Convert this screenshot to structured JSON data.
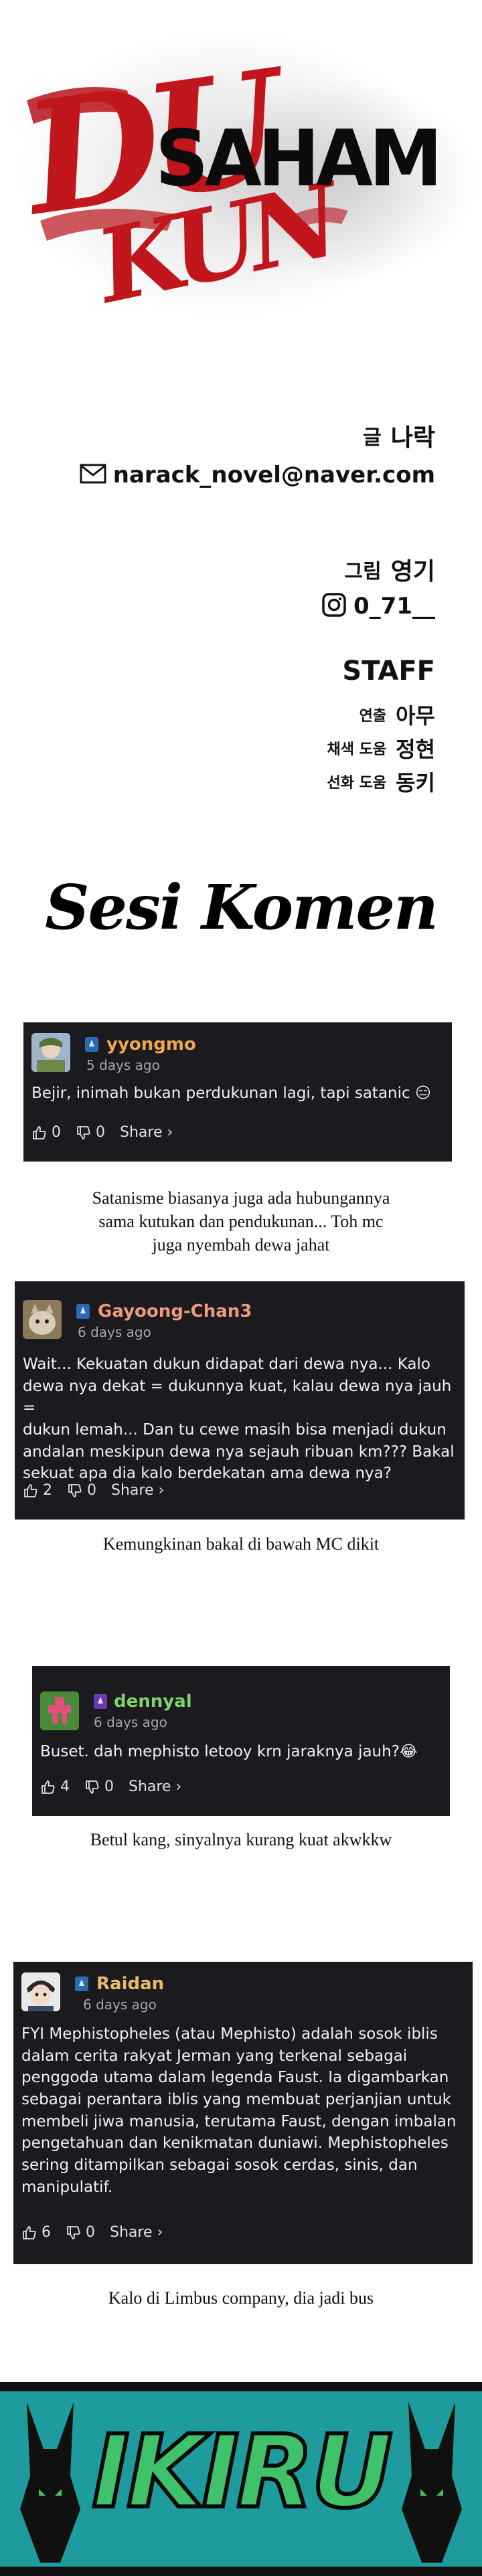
{
  "title": {
    "du": "DU",
    "kun": "KUN",
    "saham": "SAHAM"
  },
  "credits": {
    "writer_label": "글",
    "writer_name": "나락",
    "email": "narack_novel@naver.com",
    "artist_label": "그림",
    "artist_name": "영기",
    "instagram": "0_71__",
    "staff_title": "STAFF",
    "staff": [
      {
        "role": "연출",
        "name": "아무"
      },
      {
        "role": "채색 도움",
        "name": "정현"
      },
      {
        "role": "선화 도움",
        "name": "동키"
      }
    ]
  },
  "section_title": "Sesi Komen",
  "comments": [
    {
      "username": "yyongmo",
      "username_color": "#f0a64a",
      "time": "5 days ago",
      "text": "Bejir, inimah bukan perdukunan lagi, tapi satanic 😑",
      "likes": "0",
      "dislikes": "0",
      "share": "Share ›",
      "caption": "Satanisme biasanya juga ada hubungannya\nsama kutukan dan pendukunan... Toh mc\njuga nyembah dewa jahat"
    },
    {
      "username": "Gayoong-Chan3",
      "username_color": "#f0987a",
      "time": "6 days ago",
      "text": "Wait... Kekuatan dukun didapat dari dewa nya... Kalo\ndewa nya dekat = dukunnya kuat, kalau dewa nya jauh =\ndukun lemah... Dan tu cewe masih bisa menjadi dukun\nandalan meskipun dewa nya sejauh ribuan km??? Bakal\nsekuat apa dia kalo berdekatan ama dewa nya?",
      "likes": "2",
      "dislikes": "0",
      "share": "Share ›",
      "caption": "Kemungkinan bakal di bawah MC dikit"
    },
    {
      "username": "dennyal",
      "username_color": "#7fd36a",
      "time": "6 days ago",
      "text": "Buset. dah mephisto letooy krn jaraknya jauh?😂",
      "likes": "4",
      "dislikes": "0",
      "share": "Share ›",
      "caption": "Betul kang, sinyalnya kurang kuat akwkkw"
    },
    {
      "username": "Raidan",
      "username_color": "#e8b86a",
      "time": "6 days ago",
      "text": "FYI Mephistopheles (atau Mephisto) adalah sosok iblis\ndalam cerita rakyat Jerman yang terkenal sebagai\npenggoda utama dalam legenda Faust. Ia digambarkan\nsebagai perantara iblis yang membuat perjanjian untuk\nmembeli jiwa manusia, terutama Faust, dengan imbalan\npengetahuan dan kenikmatan duniawi. Mephistopheles\nsering ditampilkan sebagai sosok cerdas, sinis, dan\nmanipulatif.",
      "likes": "6",
      "dislikes": "0",
      "share": "Share ›",
      "caption": "Kalo di Limbus company, dia jadi bus"
    }
  ],
  "banner": {
    "logo_text": "IKIRU",
    "background": "#1e9c9d",
    "logo_color": "#3fc26a"
  }
}
